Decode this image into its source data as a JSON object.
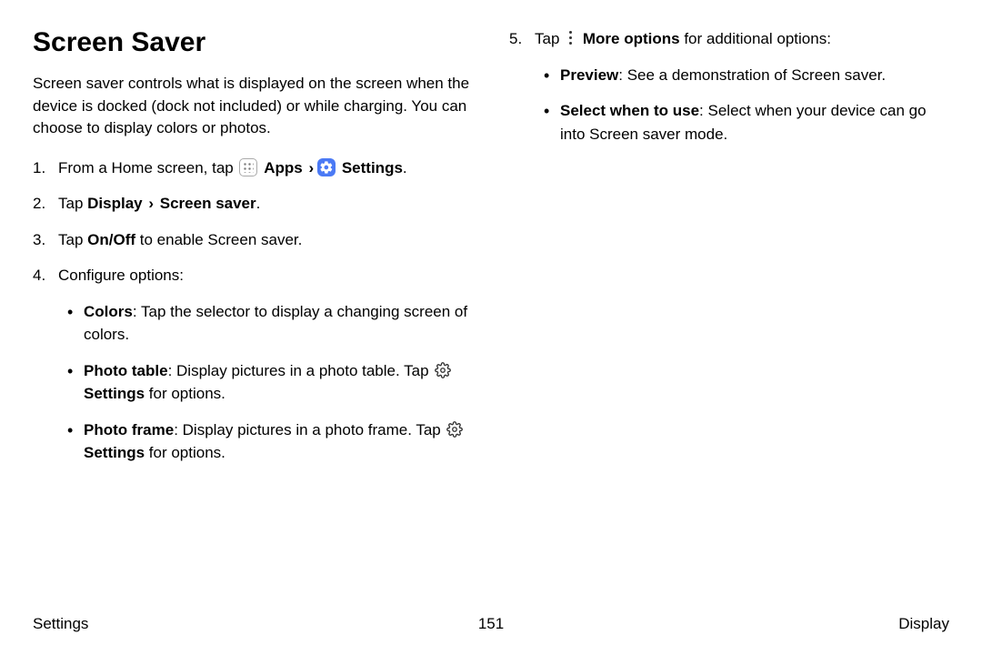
{
  "heading": "Screen Saver",
  "intro": "Screen saver controls what is displayed on the screen when the device is docked (dock not included) or while charging. You can choose to display colors or photos.",
  "step1_a": "From a Home screen, tap ",
  "apps_label": "Apps",
  "chev": "›",
  "settings_label": "Settings",
  "period": ".",
  "step2_a": "Tap ",
  "step2_display": "Display",
  "step2_screen": "Screen saver",
  "step3_a": "Tap ",
  "step3_onoff": "On/Off",
  "step3_b": " to enable Screen saver.",
  "step4": "Configure options:",
  "opt_colors_label": "Colors",
  "opt_colors_text": ": Tap the selector to display a changing screen of colors.",
  "opt_phototable_label": "Photo table",
  "opt_phototable_text": ": Display pictures in a photo table. Tap ",
  "opt_photoframe_label": "Photo frame",
  "opt_photoframe_text": ": Display pictures in a photo frame. Tap ",
  "settings_for_options": " for options.",
  "settings_word": "Settings",
  "step5_a": "Tap ",
  "step5_more": "More options",
  "step5_b": " for additional options:",
  "opt_preview_label": "Preview",
  "opt_preview_text": ": See a demonstration of Screen saver.",
  "opt_select_label": "Select when to use",
  "opt_select_text": ": Select when your device can go into Screen saver mode.",
  "footer_left": "Settings",
  "footer_center": "151",
  "footer_right": "Display"
}
